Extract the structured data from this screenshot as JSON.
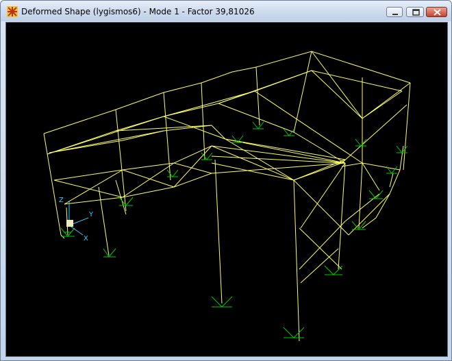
{
  "window": {
    "title": "Deformed Shape (lygismos6) - Mode 1 - Factor 39,81026",
    "controls": {
      "minimize": "minimize",
      "maximize": "maximize",
      "close": "close"
    }
  },
  "viewport": {
    "background": "#000000",
    "frame_color": "#ffff66",
    "support_color": "#00cc00",
    "axis_color": "#33ccff",
    "axes": {
      "x_label": "X",
      "y_label": "Y",
      "z_label": "Z"
    }
  }
}
